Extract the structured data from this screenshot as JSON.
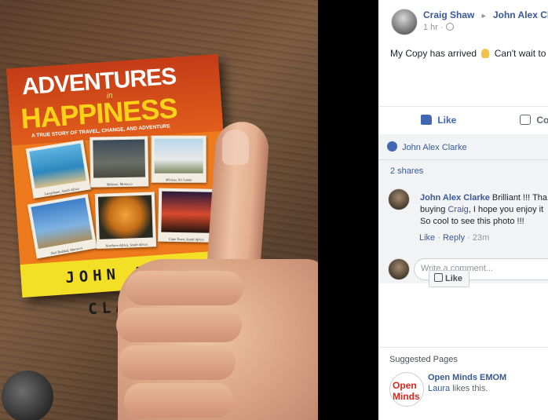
{
  "photo": {
    "book": {
      "title_line1": "ADVENTURES",
      "title_in": "in",
      "title_line2": "HAPPINESS",
      "subtitle": "A TRUE STORY OF TRAVEL, CHANGE, AND ADVENTURE",
      "author": "JOHN ALEX CLARKE",
      "captions": [
        "Langebaan, South Africa",
        "Molawe, Morocco",
        "Mirissa, Sri Lanka",
        "Jbel Toubkal, Morocco",
        "Northern Africa, South Africa",
        "Cape Town, South Africa"
      ]
    }
  },
  "post": {
    "author": "Craig Shaw",
    "target": "John Alex Cla",
    "time": "1 hr",
    "text": "My Copy has arrived",
    "text_tail": "Can't wait to",
    "like_label": "Like",
    "comment_label": "Co",
    "likes_by": "John Alex Clarke",
    "shares": "2 shares"
  },
  "comment": {
    "author": "John Alex Clarke",
    "line1": "Brilliant !!! Tha",
    "line2_a": "buying ",
    "line2_link": "Craig",
    "line2_b": ", I hope you enjoy it",
    "line3": "So cool to see this photo !!!",
    "like": "Like",
    "reply": "Reply",
    "age": "23m"
  },
  "composer": {
    "placeholder": "Write a comment..."
  },
  "suggested": {
    "heading": "Suggested Pages",
    "page_name": "Open Minds EMOM",
    "liker": "Laura",
    "liker_tail": " likes this.",
    "like_button": "Like",
    "logo_text": "Open Minds"
  }
}
